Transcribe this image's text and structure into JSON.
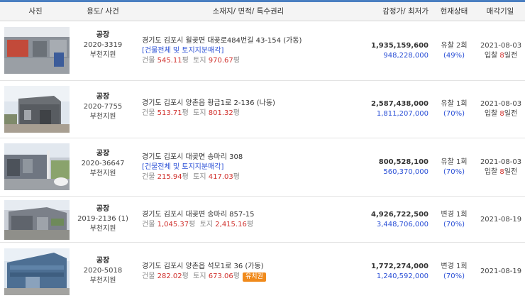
{
  "header": {
    "photo": "사진",
    "use_case": "용도/ 사건",
    "address": "소재지/ 면적/ 특수권리",
    "price": "감정가/ 최저가",
    "status": "현재상태",
    "sale_date": "매각기일"
  },
  "rows": [
    {
      "type": "공장",
      "case_no": "2020-3319",
      "court": "부천지원",
      "address": "경기도 김포시 월곶면 대곶로484번길 43-154 (가동)",
      "note": "[건물전체 및 토지지분매각]",
      "building_label": "건물",
      "building_area": "545.11",
      "land_label": "토지",
      "land_area": "970.67",
      "unit": "평",
      "badge": "",
      "appraised": "1,935,159,600",
      "minimum": "948,228,000",
      "status": "유찰 2회",
      "ratio": "(49%)",
      "date": "2021-08-03",
      "countdown_prefix": "입찰 ",
      "countdown_days": "8",
      "countdown_suffix": "일전"
    },
    {
      "type": "공장",
      "case_no": "2020-7755",
      "court": "부천지원",
      "address": "경기도 김포시 양촌읍 황금1로 2-136 (나동)",
      "note": "",
      "building_label": "건물",
      "building_area": "513.71",
      "land_label": "토지",
      "land_area": "801.32",
      "unit": "평",
      "badge": "",
      "appraised": "2,587,438,000",
      "minimum": "1,811,207,000",
      "status": "유찰 1회",
      "ratio": "(70%)",
      "date": "2021-08-03",
      "countdown_prefix": "입찰 ",
      "countdown_days": "8",
      "countdown_suffix": "일전"
    },
    {
      "type": "공장",
      "case_no": "2020-36647",
      "court": "부천지원",
      "address": "경기도 김포시 대곶면 송마리 308",
      "note": "[건물전체 및 토지지분매각]",
      "building_label": "건물",
      "building_area": "215.94",
      "land_label": "토지",
      "land_area": "417.03",
      "unit": "평",
      "badge": "",
      "appraised": "800,528,100",
      "minimum": "560,370,000",
      "status": "유찰 1회",
      "ratio": "(70%)",
      "date": "2021-08-03",
      "countdown_prefix": "입찰 ",
      "countdown_days": "8",
      "countdown_suffix": "일전"
    },
    {
      "type": "공장",
      "case_no": "2019-2136 (1)",
      "court": "부천지원",
      "address": "경기도 김포시 대곶면 송마리 857-15",
      "note": "",
      "building_label": "건물",
      "building_area": "1,045.37",
      "land_label": "토지",
      "land_area": "2,415.16",
      "unit": "평",
      "badge": "",
      "appraised": "4,926,722,500",
      "minimum": "3,448,706,000",
      "status": "변경 1회",
      "ratio": "(70%)",
      "date": "2021-08-19",
      "countdown_prefix": "",
      "countdown_days": "",
      "countdown_suffix": ""
    },
    {
      "type": "공장",
      "case_no": "2020-5018",
      "court": "부천지원",
      "address": "경기도 김포시 양촌읍 석모1로 36 (가동)",
      "note": "",
      "building_label": "건물",
      "building_area": "282.02",
      "land_label": "토지",
      "land_area": "673.06",
      "unit": "평",
      "badge": "유치권",
      "appraised": "1,772,274,000",
      "minimum": "1,240,592,000",
      "status": "변경 1회",
      "ratio": "(70%)",
      "date": "2021-08-19",
      "countdown_prefix": "",
      "countdown_days": "",
      "countdown_suffix": ""
    }
  ]
}
